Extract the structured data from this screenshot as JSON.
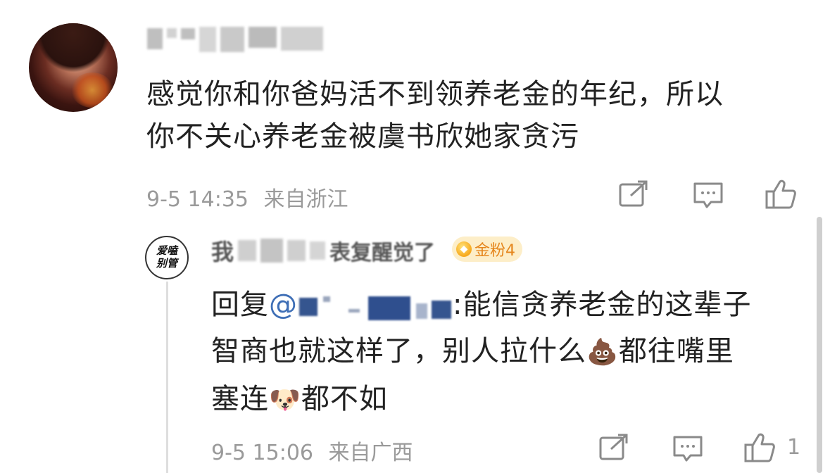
{
  "comment": {
    "author_name": "",
    "text_line1": "感觉你和你爸妈活不到领养老金的年纪，所以",
    "text_line2": "你不关心养老金被虞书欣她家贪污",
    "time": "9-5 14:35",
    "location": "来自浙江"
  },
  "reply": {
    "author_name_visible": "表复醒觉了",
    "author_prefix": "我",
    "badge": "金粉4",
    "avatar_text": "爱嗑别管",
    "reply_prefix": "回复",
    "mention_at": "@",
    "text_part1": ":能信贪养老金的这辈子",
    "text_part2": "智商也就这样了，别人拉什么",
    "text_part3": "都往嘴里",
    "text_part4": "塞连",
    "text_part5": "都不如",
    "emoji_poop": "💩",
    "emoji_dog": "🐶",
    "time": "9-5 15:06",
    "location": "来自广西",
    "like_count": "1"
  },
  "icons": {
    "share": "share-icon",
    "comment": "comment-icon",
    "like": "thumbs-up-icon"
  },
  "colors": {
    "text": "#222222",
    "meta": "#9a9a9a",
    "mention": "#3f6fb6",
    "badge_text": "#e5861c",
    "badge_bg": "#fdeec8"
  }
}
